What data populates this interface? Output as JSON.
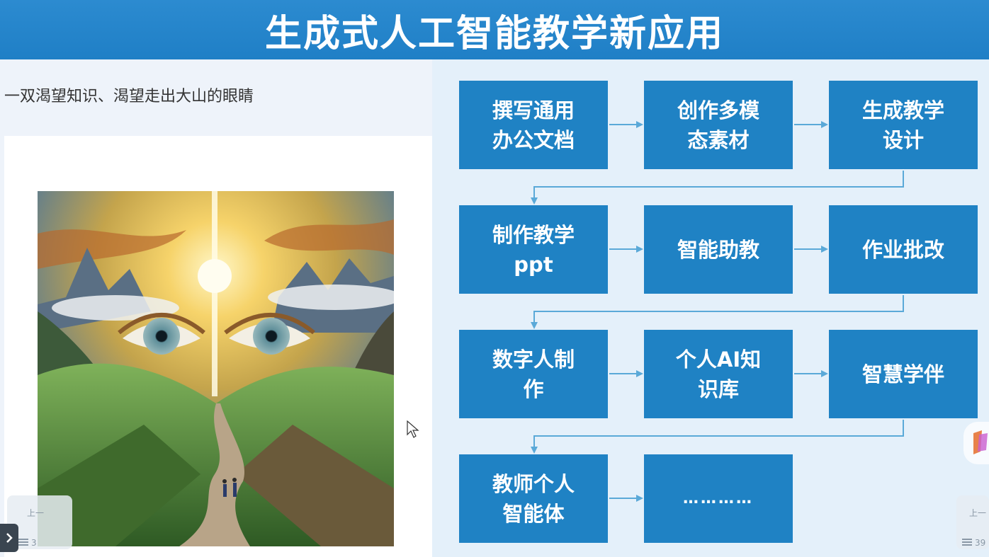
{
  "slide": {
    "title": "生成式人工智能教学新应用",
    "caption": "一双渴望知识、渴望走出大山的眼睛",
    "boxes": [
      {
        "lines": [
          "撰写通用",
          "办公文档"
        ]
      },
      {
        "lines": [
          "创作多模",
          "态素材"
        ]
      },
      {
        "lines": [
          "生成教学",
          "设计"
        ]
      },
      {
        "lines": [
          "制作教学",
          "ppt"
        ]
      },
      {
        "lines": [
          "智能助教"
        ]
      },
      {
        "lines": [
          "作业批改"
        ]
      },
      {
        "lines": [
          "数字人制",
          "作"
        ]
      },
      {
        "lines": [
          "个人AI知",
          "识库"
        ]
      },
      {
        "lines": [
          "智慧学伴"
        ]
      },
      {
        "lines": [
          "教师个人",
          "智能体"
        ]
      },
      {
        "lines": [
          "…………"
        ]
      }
    ]
  },
  "colors": {
    "header": "#1f7fc6",
    "box": "#1f82c4",
    "arrow": "#5aa9d8",
    "panel": "#e4f0fa"
  },
  "overlay": {
    "left_thumb_label": "上一",
    "left_page_fragment": "3",
    "right_thumb_label": "上一",
    "right_page_fragment": "39"
  },
  "icons": {
    "prev": "chevron-right-icon",
    "cursor": "mouse-pointer-icon",
    "menu": "menu-icon"
  }
}
